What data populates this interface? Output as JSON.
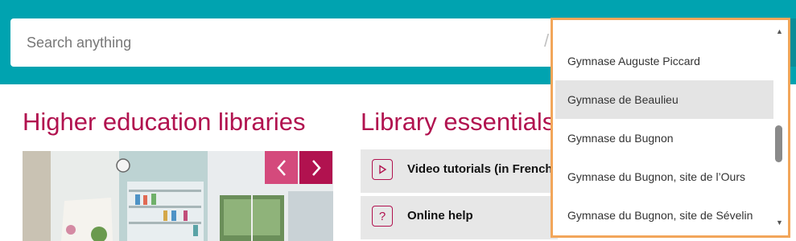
{
  "search": {
    "placeholder": "Search anything",
    "separator": "/"
  },
  "sections": {
    "libraries_title": "Higher education libraries",
    "essentials_title": "Library essentials"
  },
  "carousel": {
    "prev_icon": "chevron-left-icon",
    "next_icon": "chevron-right-icon"
  },
  "essentials": [
    {
      "label": "Video tutorials (in French",
      "icon": "play-icon"
    },
    {
      "label": "Online help",
      "icon": "help-icon"
    }
  ],
  "dropdown": {
    "items": [
      {
        "label": "Gymnase Auguste Piccard"
      },
      {
        "label": "Gymnase de Beaulieu"
      },
      {
        "label": "Gymnase du Bugnon"
      },
      {
        "label": "Gymnase du Bugnon, site de l’Ours"
      },
      {
        "label": "Gymnase du Bugnon, site de Sévelin"
      }
    ],
    "selected_index": 1
  },
  "colors": {
    "header": "#00a3b0",
    "accent": "#b1124f",
    "dropdown_border": "#f2a65a"
  }
}
